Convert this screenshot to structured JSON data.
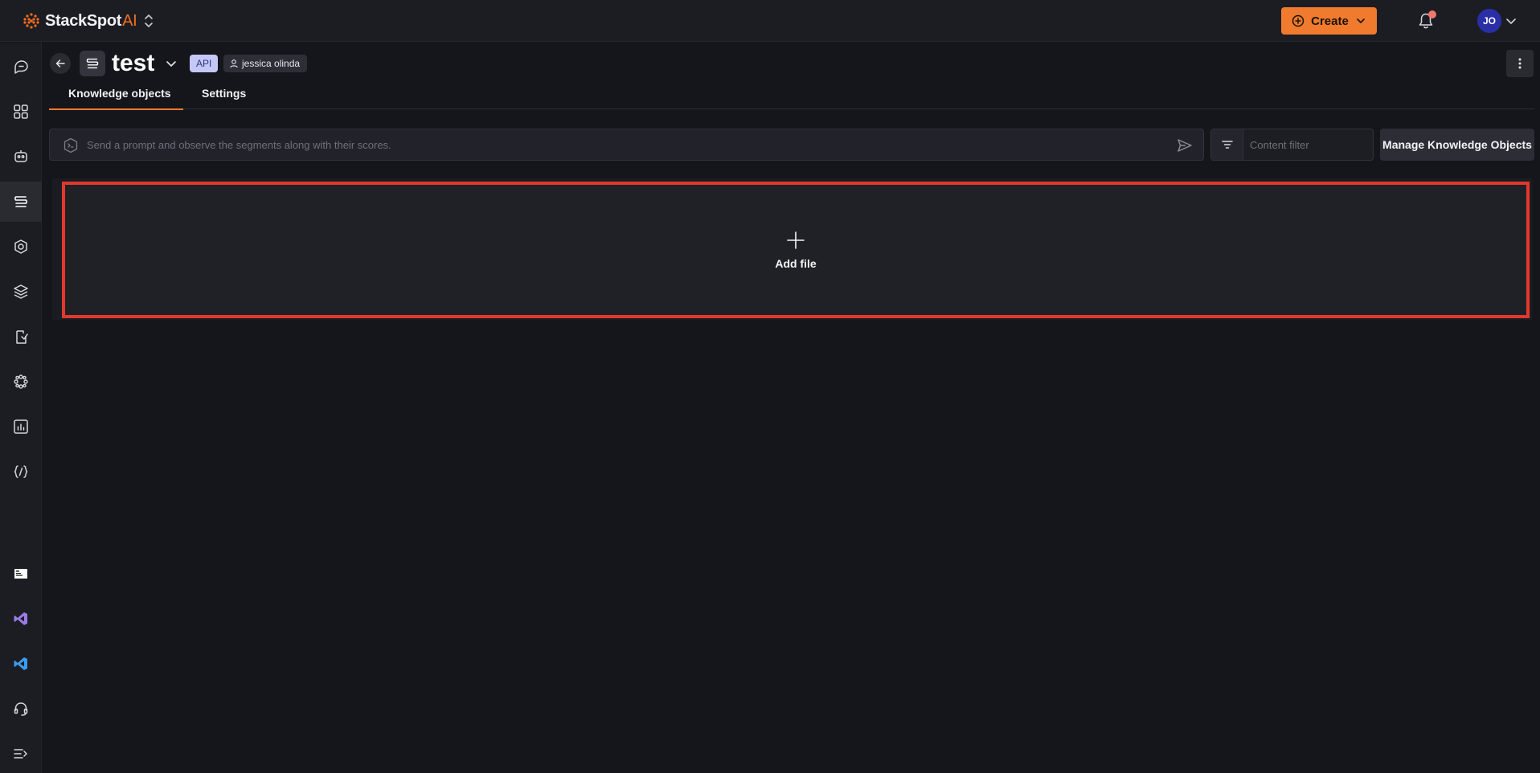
{
  "app": {
    "logo_text": "StackSpot",
    "logo_suffix": "AI"
  },
  "topbar": {
    "create_label": "Create",
    "avatar_initials": "JO",
    "has_notification": true
  },
  "rail": {
    "items": [
      {
        "icon": "chat-icon"
      },
      {
        "icon": "dashboard-icon"
      },
      {
        "icon": "agent-icon"
      },
      {
        "icon": "knowledge-source-icon",
        "active": true
      },
      {
        "icon": "shield-icon"
      },
      {
        "icon": "layers-icon"
      },
      {
        "icon": "clipboard-icon"
      },
      {
        "icon": "workspace-icon"
      },
      {
        "icon": "analytics-icon"
      },
      {
        "icon": "code-braces-icon"
      }
    ],
    "bottom_items": [
      {
        "icon": "terminal-icon"
      },
      {
        "icon": "visual-studio-icon"
      },
      {
        "icon": "vscode-icon"
      },
      {
        "icon": "headset-icon"
      },
      {
        "icon": "collapse-menu-icon"
      }
    ]
  },
  "header": {
    "title": "test",
    "type_badge": "API",
    "owner": "jessica olinda"
  },
  "tabs": [
    {
      "label": "Knowledge objects",
      "active": true
    },
    {
      "label": "Settings",
      "active": false
    }
  ],
  "prompt": {
    "placeholder": "Send a prompt and observe the segments along with their scores."
  },
  "filter": {
    "placeholder": "Content filter"
  },
  "manage_button": "Manage Knowledge Objects",
  "dropzone": {
    "label": "Add file"
  },
  "colors": {
    "accent": "#f07a2e",
    "highlight": "#e2392c",
    "background": "#15161b"
  }
}
